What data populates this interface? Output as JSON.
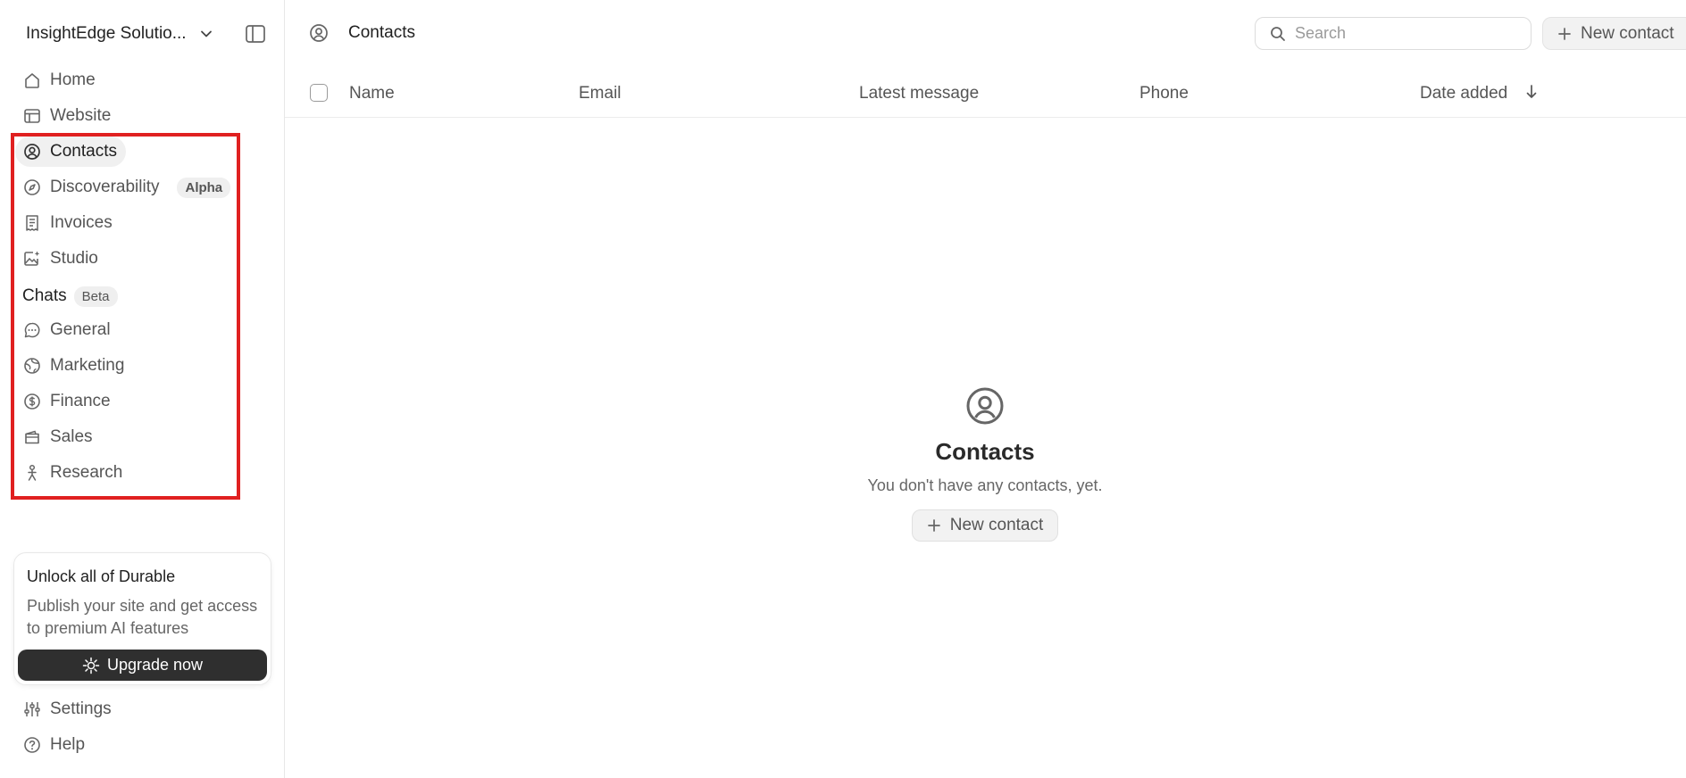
{
  "workspace": {
    "name": "InsightEdge Solutio..."
  },
  "sidebar": {
    "items": [
      {
        "label": "Home",
        "icon": "home-icon"
      },
      {
        "label": "Website",
        "icon": "website-icon"
      },
      {
        "label": "Contacts",
        "icon": "contacts-icon",
        "active": true
      },
      {
        "label": "Discoverability",
        "icon": "compass-icon",
        "badge": "Alpha"
      },
      {
        "label": "Invoices",
        "icon": "receipt-icon"
      },
      {
        "label": "Studio",
        "icon": "image-sparkle-icon"
      }
    ],
    "chats": {
      "label": "Chats",
      "badge": "Beta",
      "items": [
        {
          "label": "General",
          "icon": "chat-bubble-icon"
        },
        {
          "label": "Marketing",
          "icon": "globe-icon"
        },
        {
          "label": "Finance",
          "icon": "dollar-icon"
        },
        {
          "label": "Sales",
          "icon": "wallet-icon"
        },
        {
          "label": "Research",
          "icon": "person-research-icon"
        }
      ]
    },
    "bottom": [
      {
        "label": "Settings",
        "icon": "settings-sliders-icon"
      },
      {
        "label": "Help",
        "icon": "help-icon"
      }
    ]
  },
  "promo": {
    "title": "Unlock all of Durable",
    "text": "Publish your site and get access to premium AI features",
    "button": "Upgrade now"
  },
  "header": {
    "title": "Contacts",
    "search_placeholder": "Search",
    "new_contact_label": "New contact"
  },
  "table": {
    "columns": [
      "Name",
      "Email",
      "Latest message",
      "Phone",
      "Date added"
    ]
  },
  "empty_state": {
    "title": "Contacts",
    "message": "You don't have any contacts, yet.",
    "button": "New contact"
  },
  "colors": {
    "accent_dark": "#2f2f2f",
    "highlight_border": "#e02020",
    "active_bg": "#f0f0f0"
  }
}
